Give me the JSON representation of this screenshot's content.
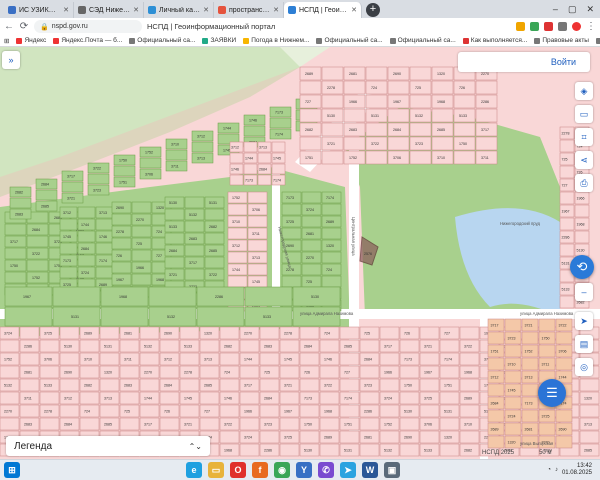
{
  "browser": {
    "tabs": [
      {
        "title": "ИС УЗИКОМНО 2.4.3...",
        "favicon_color": "#3a6fc4",
        "active": false
      },
      {
        "title": "СЭД Нижегородская...",
        "favicon_color": "#666666",
        "active": false
      },
      {
        "title": "Личный кабинет",
        "favicon_color": "#2d8fd5",
        "active": false
      },
      {
        "title": "пространственные д...",
        "favicon_color": "#e5533d",
        "active": false
      },
      {
        "title": "НСПД | Геоинформ...",
        "favicon_color": "#2d7fd5",
        "active": true
      }
    ],
    "new_tab_label": "+",
    "url": "nspd.gov.ru",
    "page_title": "НСПД | Геоинформационный портал",
    "bookmarks": [
      {
        "label": "Яндекс",
        "color": "#e33"
      },
      {
        "label": "Яндекс.Почта — б...",
        "color": "#e33"
      },
      {
        "label": "Официальный са...",
        "color": "#777"
      },
      {
        "label": "ЗАЯВКИ",
        "color": "#2a8"
      },
      {
        "label": "Погода в Нижнем...",
        "color": "#f7b500"
      },
      {
        "label": "Официальный са...",
        "color": "#777"
      },
      {
        "label": "Официальный са...",
        "color": "#777"
      },
      {
        "label": "Как выполняется...",
        "color": "#d33"
      },
      {
        "label": "Правовые акты",
        "color": "#777"
      },
      {
        "label": "Официальный са...",
        "color": "#777"
      }
    ]
  },
  "map": {
    "login_label": "Войти",
    "legend_label": "Легенда",
    "attribution": "НСПД 2025",
    "scale": "50 м",
    "streets": {
      "admiral_nakhimov": "улица Адмирала Нахимова",
      "nizhegorodskaya": "Нижегородская улица",
      "tsentralnaya": "Центральная улица",
      "vygorskaya": "улица Выгорская",
      "pond": "Нижегородский пруд"
    },
    "parcel_labels": [
      "2682",
      "2683",
      "2684",
      "2685",
      "3717",
      "3721",
      "3722",
      "3723",
      "1750",
      "1751",
      "1752",
      "3706",
      "3710",
      "3711",
      "3712",
      "3713",
      "1744",
      "1745",
      "1746",
      "2684",
      "7173",
      "7174",
      "3724",
      "3725",
      "2689",
      "2681",
      "2690",
      "1320",
      "2270",
      "2278",
      "724",
      "725",
      "726",
      "727",
      "1966",
      "1967",
      "1968",
      "2286",
      "5130",
      "5131",
      "5132",
      "5133"
    ],
    "selected_parcel_label": "2576",
    "colors": {
      "green_parcel": "#a8d08d",
      "green_border": "#6b9c45",
      "pink_parcel": "#f9d7d7",
      "pink_border": "#c98585",
      "water": "#b8d6f0",
      "selected": "#8b5a5a",
      "accent": "#2b74d6"
    }
  },
  "taskbar": {
    "time": "13:42",
    "date": "01.08.2025",
    "apps": [
      {
        "name": "edge",
        "color": "#1fa0e0",
        "glyph": "e"
      },
      {
        "name": "explorer",
        "color": "#e8b33a",
        "glyph": "▭"
      },
      {
        "name": "opera",
        "color": "#e0302b",
        "glyph": "O"
      },
      {
        "name": "firefox",
        "color": "#e86a1f",
        "glyph": "f"
      },
      {
        "name": "chrome",
        "color": "#3aa657",
        "glyph": "◉"
      },
      {
        "name": "yandex",
        "color": "#3870c4",
        "glyph": "Y"
      },
      {
        "name": "viber",
        "color": "#7a4bd0",
        "glyph": "✆"
      },
      {
        "name": "telegram",
        "color": "#2aa3e0",
        "glyph": "➤"
      },
      {
        "name": "word",
        "color": "#2b5797",
        "glyph": "W"
      },
      {
        "name": "monitor",
        "color": "#5a6a7a",
        "glyph": "▣"
      }
    ]
  }
}
